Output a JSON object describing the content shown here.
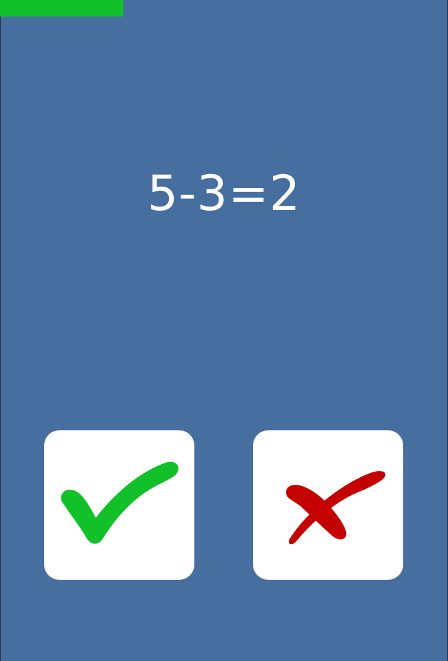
{
  "game": {
    "equation": "5-3=2",
    "timer": {
      "remaining_fraction": 0.275,
      "color": "#12c12a"
    },
    "background_color": "#466e9f",
    "buttons": {
      "correct": {
        "icon": "checkmark-icon",
        "color": "#12c12a"
      },
      "wrong": {
        "icon": "cross-icon",
        "color": "#c40000"
      }
    }
  }
}
